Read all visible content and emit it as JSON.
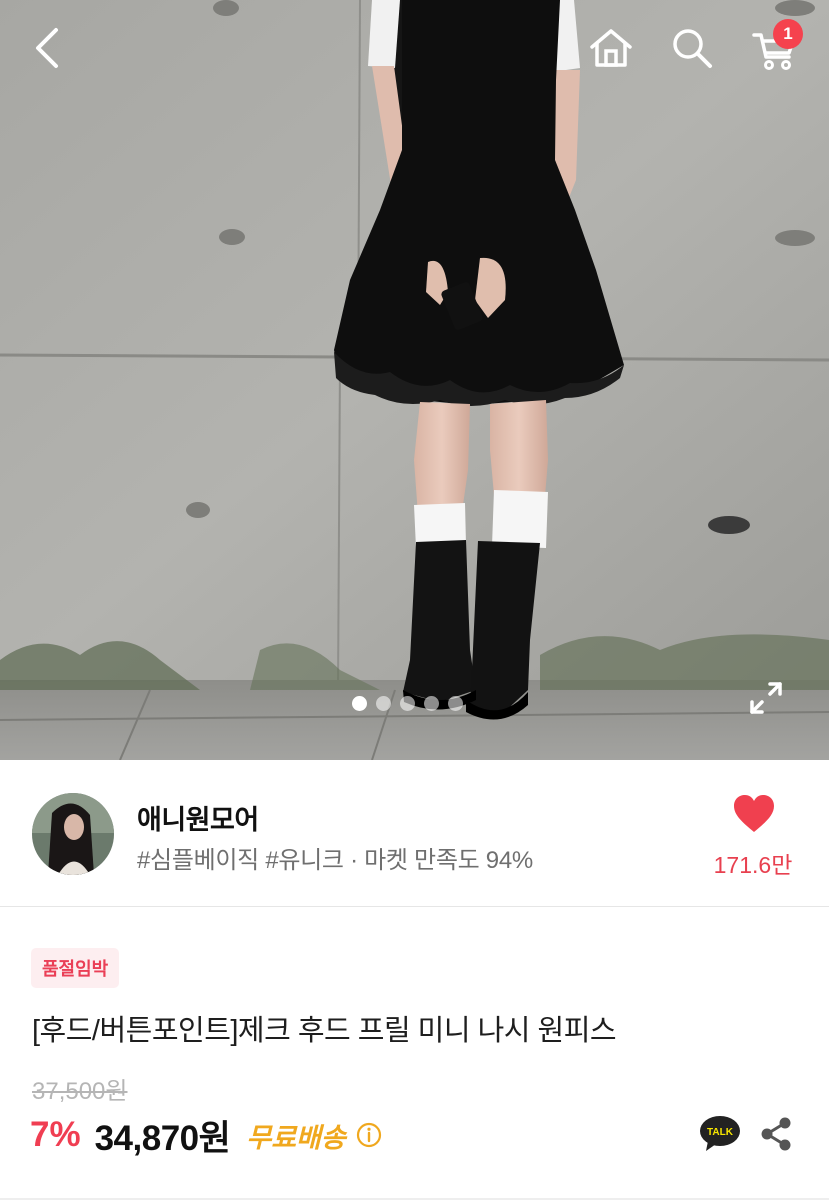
{
  "header": {
    "back_icon": "chevron-left-icon",
    "home_icon": "home-icon",
    "search_icon": "search-icon",
    "cart_icon": "cart-icon",
    "cart_count": "1"
  },
  "gallery": {
    "image_count": 5,
    "current_index": 1,
    "expand_icon": "expand-icon"
  },
  "shop": {
    "name": "애니원모어",
    "tags": "#심플베이직 #유니크 · 마켓 만족도 94%",
    "like_count": "171.6만",
    "like_color": "#f0404f"
  },
  "product": {
    "badge": "품절임박",
    "title": "[후드/버튼포인트]제크 후드 프릴 미니 나시 원피스",
    "original_price": "37,500원",
    "discount": "7%",
    "price": "34,870원",
    "shipping": "무료배송",
    "talk_label": "TALK"
  },
  "colors": {
    "accent": "#f03e52",
    "shipping": "#f0a81e"
  }
}
